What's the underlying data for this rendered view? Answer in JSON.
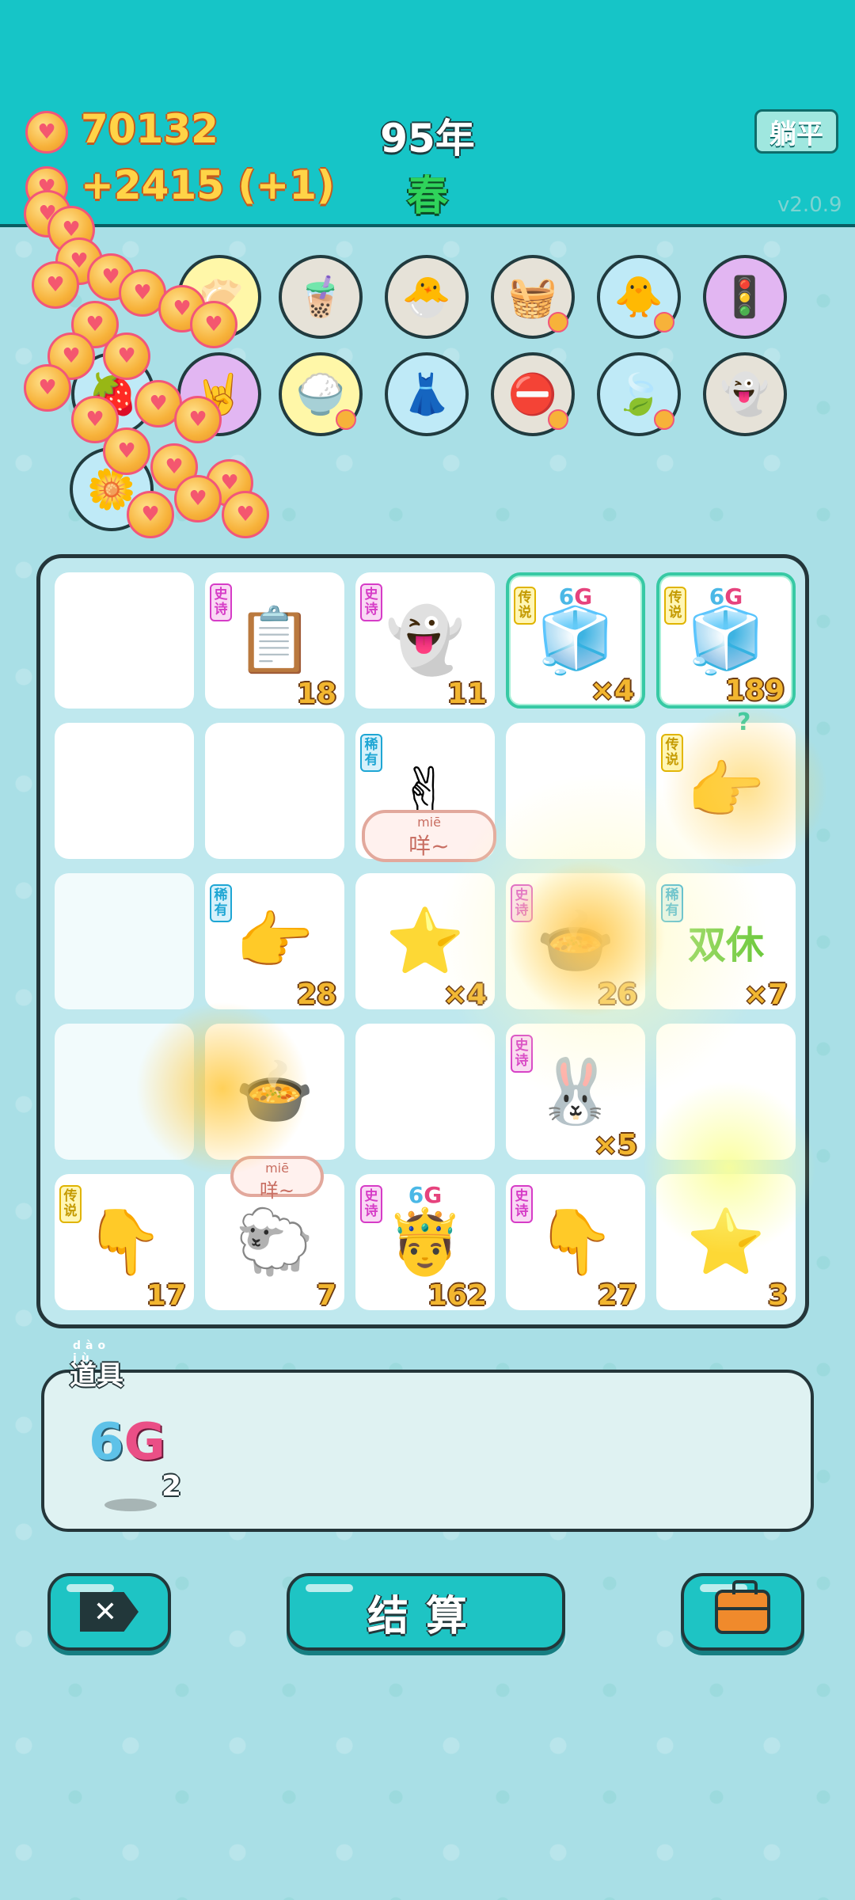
{
  "header": {
    "coins": "70132",
    "income": "+2415 (+1)",
    "year": "95年",
    "season": "春",
    "flat_button": "躺平",
    "version": "v2.0.9"
  },
  "relics": [
    {
      "icon": "dumplings-icon",
      "glyph": "🥟"
    },
    {
      "icon": "bubble-tea-icon",
      "glyph": "🧋"
    },
    {
      "icon": "chicken-egg-icon",
      "glyph": "🐣"
    },
    {
      "icon": "fruit-basket-icon",
      "glyph": "🧺"
    },
    {
      "icon": "chick-egg-icon",
      "glyph": "🐥"
    },
    {
      "icon": "traffic-light-icon",
      "glyph": "🚦"
    },
    {
      "icon": "strawberry-basket-icon",
      "glyph": "🍓"
    },
    {
      "icon": "rock-hand-icon",
      "glyph": "🤘"
    },
    {
      "icon": "rice-bowl-icon",
      "glyph": "🍚"
    },
    {
      "icon": "pleated-skirt-icon",
      "glyph": "👗"
    },
    {
      "icon": "no-entry-icon",
      "glyph": "⛔"
    },
    {
      "icon": "leaf-icon",
      "glyph": "🍃"
    },
    {
      "icon": "ghost-tongue-icon",
      "glyph": "👻"
    },
    {
      "icon": "flower-pot-icon",
      "glyph": "🌼"
    }
  ],
  "board": {
    "tiles": [
      {
        "name": "empty",
        "tag": "",
        "tagtype": "",
        "glyph": "",
        "count": ""
      },
      {
        "name": "copy-paste-card",
        "tag": "史诗",
        "tagtype": "epic",
        "glyph": "📋",
        "count": "18"
      },
      {
        "name": "ghost",
        "tag": "史诗",
        "tagtype": "epic",
        "glyph": "👻",
        "count": "11"
      },
      {
        "name": "6g-fridge",
        "tag": "传说",
        "tagtype": "legend",
        "glyph": "🧊",
        "count": "×4",
        "g6": true,
        "hl": true
      },
      {
        "name": "6g-fridge",
        "tag": "传说",
        "tagtype": "legend",
        "glyph": "🧊",
        "count": "189",
        "g6": true,
        "hl": true
      },
      {
        "name": "empty",
        "tag": "",
        "tagtype": "",
        "glyph": "",
        "count": ""
      },
      {
        "name": "empty",
        "tag": "",
        "tagtype": "",
        "glyph": "",
        "count": ""
      },
      {
        "name": "brown-hand",
        "tag": "稀有",
        "tagtype": "rare",
        "glyph": "✌",
        "count": ""
      },
      {
        "name": "empty",
        "tag": "",
        "tagtype": "",
        "glyph": "",
        "count": ""
      },
      {
        "name": "gold-hand",
        "tag": "传说",
        "tagtype": "legend",
        "glyph": "👉",
        "count": ""
      },
      {
        "name": "coins-pile",
        "tag": "",
        "tagtype": "",
        "glyph": "",
        "count": ""
      },
      {
        "name": "pointing-hand",
        "tag": "稀有",
        "tagtype": "rare",
        "glyph": "👉",
        "count": "28"
      },
      {
        "name": "star",
        "tag": "",
        "tagtype": "",
        "glyph": "⭐",
        "count": "×4"
      },
      {
        "name": "pot",
        "tag": "史诗",
        "tagtype": "epic",
        "glyph": "🍲",
        "count": "26"
      },
      {
        "name": "double-rest",
        "tag": "稀有",
        "tagtype": "rare",
        "glyph": "",
        "count": "×7",
        "text": "双休"
      },
      {
        "name": "coins-pile",
        "tag": "",
        "tagtype": "",
        "glyph": "",
        "count": ""
      },
      {
        "name": "pot-burst",
        "tag": "",
        "tagtype": "",
        "glyph": "🍲",
        "count": ""
      },
      {
        "name": "empty",
        "tag": "",
        "tagtype": "",
        "glyph": "",
        "count": ""
      },
      {
        "name": "rabbit-house",
        "tag": "史诗",
        "tagtype": "epic",
        "glyph": "🐰",
        "count": "×5"
      },
      {
        "name": "empty",
        "tag": "",
        "tagtype": "",
        "glyph": "",
        "count": ""
      },
      {
        "name": "yellow-hand",
        "tag": "传说",
        "tagtype": "legend",
        "glyph": "👇",
        "count": "17"
      },
      {
        "name": "sheep",
        "tag": "",
        "tagtype": "",
        "glyph": "🐑",
        "count": "7"
      },
      {
        "name": "6g-king",
        "tag": "史诗",
        "tagtype": "epic",
        "glyph": "🤴",
        "count": "162",
        "g6": true
      },
      {
        "name": "grey-hand",
        "tag": "史诗",
        "tagtype": "epic",
        "glyph": "👇",
        "count": "27"
      },
      {
        "name": "star-sheep",
        "tag": "",
        "tagtype": "",
        "glyph": "⭐",
        "count": "3"
      }
    ],
    "bubble1": {
      "pinyin": "miē",
      "text": "咩~"
    },
    "bubble2": {
      "pinyin": "miē",
      "text": "咩~"
    },
    "question": "?"
  },
  "items": {
    "title": "道具",
    "title_pinyin": "dào jù",
    "g6_six": "6",
    "g6_g": "G",
    "g6_count": "2"
  },
  "buttons": {
    "skip": "✕",
    "settle": "结算"
  },
  "colors": {
    "header": "#16c5c7",
    "background": "#a9dfe6",
    "coin": "#f7b23a",
    "count_text": "#f2b62f",
    "season": "#2fd35b"
  }
}
